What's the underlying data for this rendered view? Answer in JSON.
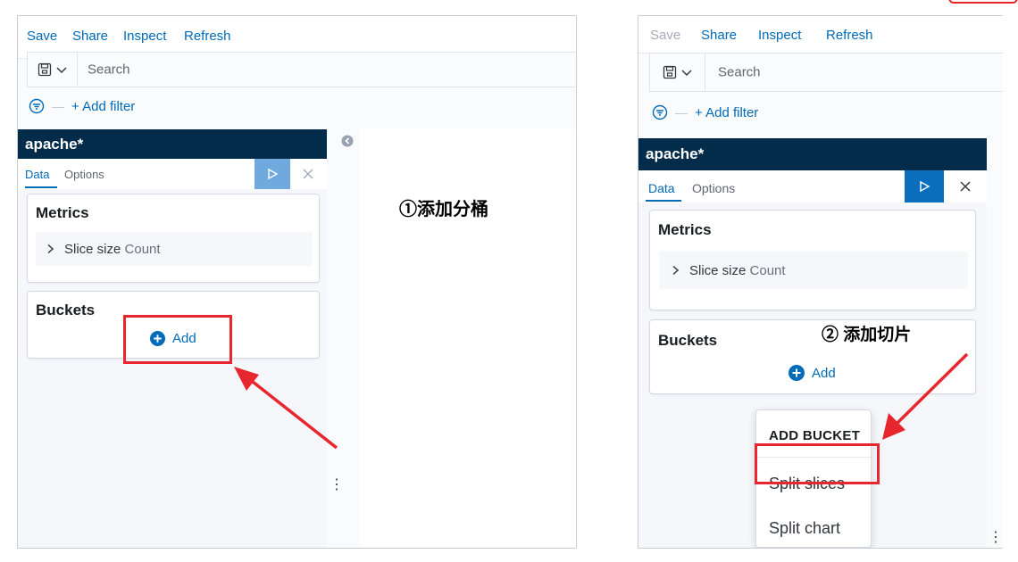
{
  "left": {
    "nav": {
      "save": "Save",
      "share": "Share",
      "inspect": "Inspect",
      "refresh": "Refresh"
    },
    "search": {
      "placeholder": "Search"
    },
    "filter": {
      "add": "+ Add filter"
    },
    "index_pattern": "apache*",
    "tabs": {
      "data": "Data",
      "options": "Options"
    },
    "metrics": {
      "title": "Metrics",
      "agg_label": "Slice size",
      "agg_value": "Count"
    },
    "buckets": {
      "title": "Buckets",
      "add": "Add"
    },
    "annotation": "①添加分桶"
  },
  "right": {
    "nav": {
      "save": "Save",
      "share": "Share",
      "inspect": "Inspect",
      "refresh": "Refresh"
    },
    "search": {
      "placeholder": "Search"
    },
    "filter": {
      "add": "+ Add filter"
    },
    "index_pattern": "apache*",
    "tabs": {
      "data": "Data",
      "options": "Options"
    },
    "metrics": {
      "title": "Metrics",
      "agg_label": "Slice size",
      "agg_value": "Count"
    },
    "buckets": {
      "title": "Buckets",
      "add": "Add"
    },
    "popover": {
      "title": "ADD BUCKET",
      "items": [
        "Split slices",
        "Split chart"
      ]
    },
    "annotation": "② 添加切片"
  },
  "colors": {
    "accent": "#006bb8",
    "header_bg": "#032b4a",
    "highlight": "#e8262e"
  },
  "icons": [
    "save-icon",
    "chevron-down-icon",
    "filter-icon",
    "play-icon",
    "close-icon",
    "chevron-right-icon",
    "plus-circle-icon",
    "collapse-icon",
    "kebab-icon"
  ]
}
